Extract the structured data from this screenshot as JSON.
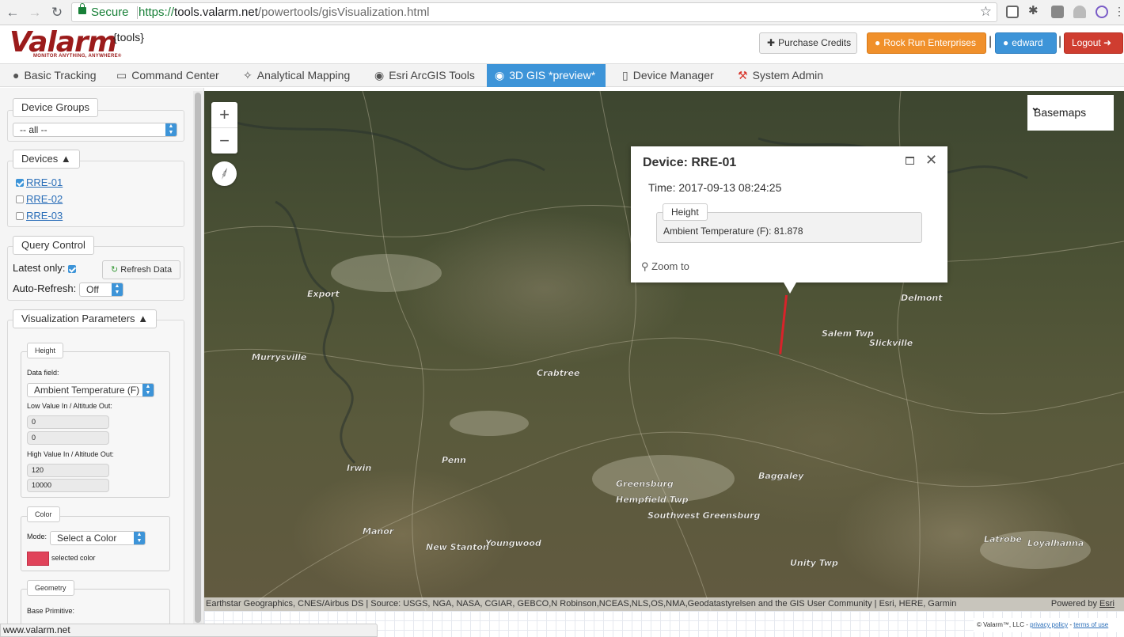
{
  "browser": {
    "secure_label": "Secure",
    "url_scheme": "https://",
    "url_host": "tools.valarm.net",
    "url_path": "/powertools/gisVisualization.html",
    "status_url": "www.valarm.net"
  },
  "header": {
    "logo_text": "Valarm",
    "logo_tagline": "MONITOR ANYTHING, ANYWHERE®",
    "tools_label": "{tools}",
    "purchase_credits": "Purchase Credits",
    "organization": "Rock Run Enterprises",
    "user": "edward",
    "logout": "Logout"
  },
  "nav": {
    "tabs": [
      {
        "label": "Basic Tracking",
        "icon": "map-pin-icon"
      },
      {
        "label": "Command Center",
        "icon": "monitor-icon"
      },
      {
        "label": "Analytical Mapping",
        "icon": "crosshair-icon"
      },
      {
        "label": "Esri ArcGIS Tools",
        "icon": "globe-icon"
      },
      {
        "label": "3D GIS *preview*",
        "icon": "globe-icon",
        "active": true
      },
      {
        "label": "Device Manager",
        "icon": "device-icon"
      },
      {
        "label": "System Admin",
        "icon": "wrench-icon"
      }
    ]
  },
  "sidebar": {
    "device_groups": {
      "title": "Device Groups",
      "selected": "-- all --"
    },
    "devices": {
      "title": "Devices",
      "items": [
        {
          "label": "RRE-01",
          "checked": true
        },
        {
          "label": "RRE-02",
          "checked": false
        },
        {
          "label": "RRE-03",
          "checked": false
        }
      ]
    },
    "query_control": {
      "title": "Query Control",
      "latest_only_label": "Latest only:",
      "latest_only_checked": true,
      "refresh_label": "Refresh Data",
      "auto_refresh_label": "Auto-Refresh:",
      "auto_refresh_value": "Off"
    },
    "viz": {
      "title": "Visualization Parameters",
      "height": {
        "title": "Height",
        "data_field_label": "Data field:",
        "data_field_value": "Ambient Temperature (F)",
        "low_label": "Low Value In / Altitude Out:",
        "low_in": "0",
        "low_out": "0",
        "high_label": "High Value In / Altitude Out:",
        "high_in": "120",
        "high_out": "10000"
      },
      "color": {
        "title": "Color",
        "mode_label": "Mode:",
        "mode_value": "Select a Color",
        "swatch_label": "selected color",
        "swatch_color": "#e0435a"
      },
      "geometry": {
        "title": "Geometry",
        "base_primitive_label": "Base Primitive:"
      }
    }
  },
  "map": {
    "basemaps_label": "Basemaps",
    "zoom_in": "+",
    "zoom_out": "−",
    "attribution": "Earthstar Geographics, CNES/Airbus DS | Source: USGS, NGA, NASA, CGIAR, GEBCO,N Robinson,NCEAS,NLS,OS,NMA,Geodatastyrelsen and the GIS User Community | Esri, HERE, Garmin",
    "powered_by": "Powered by",
    "powered_by_link": "Esri",
    "marker_color": "#d8232a",
    "place_labels": [
      "Salem Twp",
      "Slickville",
      "Delmont",
      "Greensburg",
      "Youngwood",
      "Latrobe",
      "Loyalhanna",
      "Unity Twp",
      "Baggaley",
      "New Stanton",
      "Hempfield Twp",
      "Southwest Greensburg",
      "Manor",
      "Export",
      "Murrysville",
      "Irwin",
      "Penn",
      "Crabtree"
    ]
  },
  "popup": {
    "title": "Device: RRE-01",
    "time": "Time: 2017-09-13 08:24:25",
    "section_title": "Height",
    "field_value": "Ambient Temperature (F): 81.878",
    "zoom_to": "Zoom to"
  },
  "footer": {
    "copyright": "© Valarm™, LLC -",
    "privacy": "privacy policy",
    "terms": "terms of use"
  }
}
